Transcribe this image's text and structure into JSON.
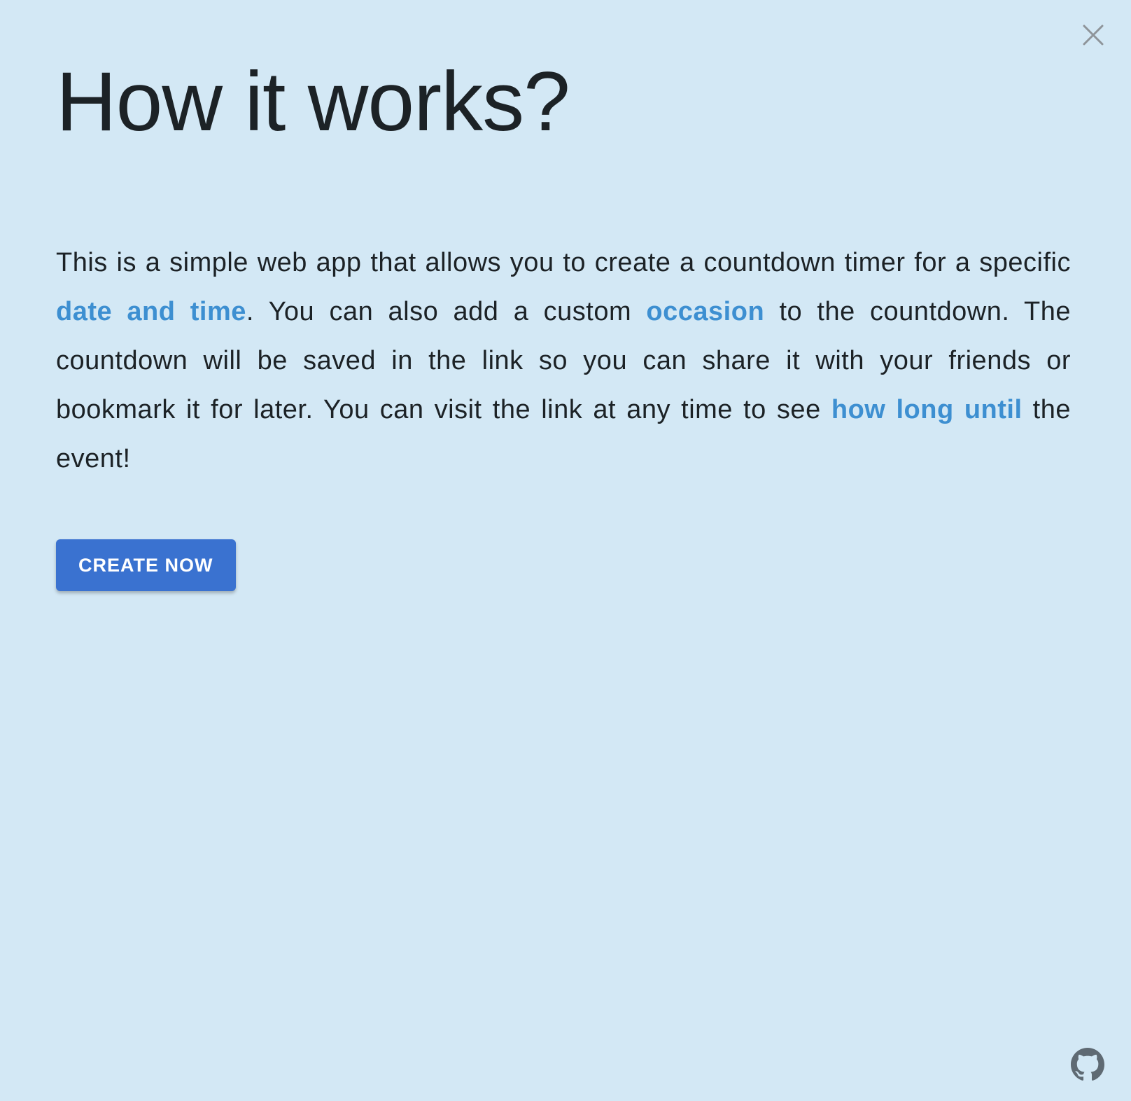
{
  "modal": {
    "title": "How it works?",
    "description": {
      "part1": "This is a simple web app that allows you to create a countdown timer for a specific ",
      "link1": "date and time",
      "part2": ". You can also add a custom ",
      "link2": "occasion",
      "part3": " to the countdown. The countdown will be saved in the link so you can share it with your friends or bookmark it for later. You can visit the link at any time to see ",
      "link3": "how long until",
      "part4": " the event!"
    },
    "cta_label": "CREATE NOW",
    "close_icon": "close-icon",
    "footer_icon": "github-icon"
  },
  "colors": {
    "background": "#d3e8f5",
    "text": "#1c2226",
    "link": "#3d8fd1",
    "button": "#3a72d0",
    "icon": "#8e9499"
  }
}
